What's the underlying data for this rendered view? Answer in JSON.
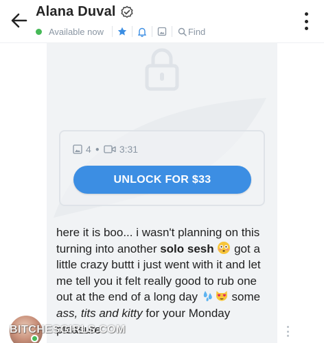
{
  "header": {
    "title": "Alana Duval",
    "status": "Available now",
    "find_label": "Find",
    "icons": [
      "back-arrow-icon",
      "verified-badge-icon",
      "star-icon",
      "bell-icon",
      "media-gallery-icon",
      "search-icon",
      "more-vertical-icon"
    ]
  },
  "locked_post": {
    "icon": "lock-icon",
    "media_count": "4",
    "video_duration": "3:31",
    "unlock_button": "UNLOCK FOR $33"
  },
  "message": {
    "p1": "here it is boo... i wasn't planning on this turning into another ",
    "bold1": "solo sesh",
    "p2": " got a little crazy buttt i just went with it and let me tell you it felt really good to rub one out at the end of a long day ",
    "p3": " some ",
    "italic1": "ass, tits and kitty",
    "p4": " for your Monday pleasure"
  },
  "watermark": "BITCHESGIRLS.COM",
  "colors": {
    "accent": "#3c8ee3",
    "online": "#46b957",
    "muted": "#8a96a3",
    "bubble": "#f1f3f5"
  }
}
